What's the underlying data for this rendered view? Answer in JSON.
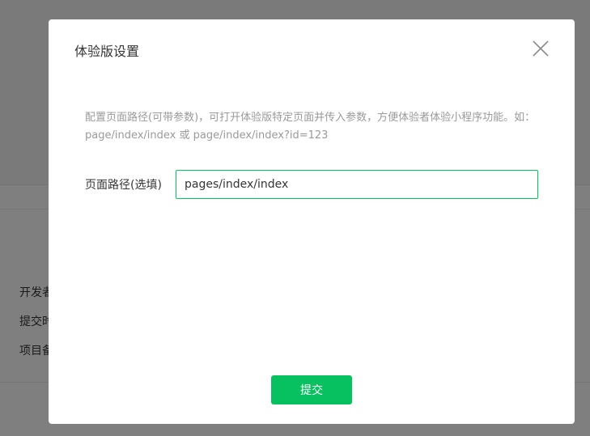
{
  "background": {
    "rows": [
      {
        "label": "开发者"
      },
      {
        "label": "提交时"
      },
      {
        "label": "项目备"
      }
    ]
  },
  "dialog": {
    "title": "体验版设置",
    "close_icon": "close-icon",
    "description": "配置页面路径(可带参数)，可打开体验版特定页面并传入参数，方便体验者体验小程序功能。如：page/index/index 或 page/index/index?id=123",
    "form": {
      "path_label": "页面路径(选填)",
      "path_value": "pages/index/index"
    },
    "submit_label": "提交"
  },
  "colors": {
    "accent": "#07c160",
    "text": "#353535",
    "muted": "#9a9a9a",
    "overlay": "rgba(0,0,0,0.5)"
  }
}
